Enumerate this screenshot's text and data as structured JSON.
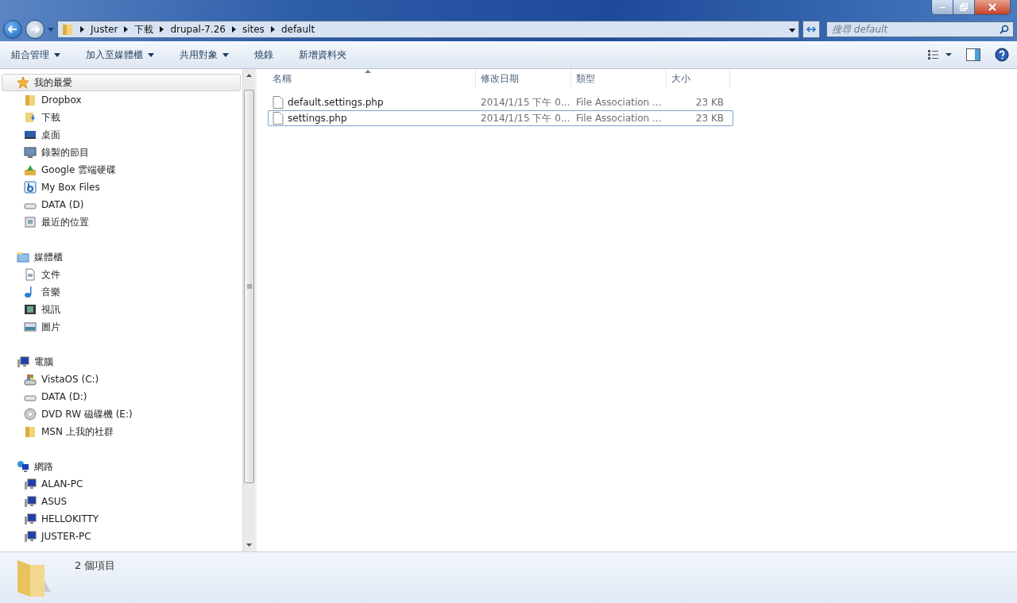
{
  "address_bar": {
    "crumbs": [
      "Juster",
      "下載",
      "drupal-7.26",
      "sites",
      "default"
    ]
  },
  "search": {
    "placeholder": "搜尋 default"
  },
  "toolbar": {
    "buttons": [
      {
        "label": "組合管理",
        "dropdown": true
      },
      {
        "label": "加入至媒體櫃",
        "dropdown": true
      },
      {
        "label": "共用對象",
        "dropdown": true
      },
      {
        "label": "燒錄",
        "dropdown": false
      },
      {
        "label": "新增資料夾",
        "dropdown": false
      }
    ]
  },
  "sidebar": {
    "groups": [
      {
        "label": "我的最愛",
        "kind": "star",
        "selected": true,
        "items": [
          {
            "label": "Dropbox",
            "kind": "folder"
          },
          {
            "label": "下載",
            "kind": "download"
          },
          {
            "label": "桌面",
            "kind": "desktop"
          },
          {
            "label": "錄製的節目",
            "kind": "monitor"
          },
          {
            "label": "Google 雲端硬碟",
            "kind": "drive"
          },
          {
            "label": "My Box Files",
            "kind": "box"
          },
          {
            "label": "DATA (D)",
            "kind": "disk"
          },
          {
            "label": "最近的位置",
            "kind": "recent"
          }
        ]
      },
      {
        "label": "媒體櫃",
        "kind": "library",
        "selected": false,
        "items": [
          {
            "label": "文件",
            "kind": "doc"
          },
          {
            "label": "音樂",
            "kind": "music"
          },
          {
            "label": "視訊",
            "kind": "film"
          },
          {
            "label": "圖片",
            "kind": "image"
          }
        ]
      },
      {
        "label": "電腦",
        "kind": "computer",
        "selected": false,
        "items": [
          {
            "label": "VistaOS (C:)",
            "kind": "sysdisk"
          },
          {
            "label": "DATA (D:)",
            "kind": "disk"
          },
          {
            "label": "DVD RW 磁碟機 (E:)",
            "kind": "dvd"
          },
          {
            "label": "MSN 上我的社群",
            "kind": "folder"
          }
        ]
      },
      {
        "label": "網路",
        "kind": "network",
        "selected": false,
        "items": [
          {
            "label": "ALAN-PC",
            "kind": "computer"
          },
          {
            "label": "ASUS",
            "kind": "computer"
          },
          {
            "label": "HELLOKITTY",
            "kind": "computer"
          },
          {
            "label": "JUSTER-PC",
            "kind": "computer"
          }
        ]
      }
    ]
  },
  "table": {
    "columns": [
      "名稱",
      "修改日期",
      "類型",
      "大小"
    ],
    "rows": [
      {
        "name": "default.settings.php",
        "modified": "2014/1/15 下午 0...",
        "type": "File Association ...",
        "size": "23 KB",
        "focused": false
      },
      {
        "name": "settings.php",
        "modified": "2014/1/15 下午 0...",
        "type": "File Association ...",
        "size": "23 KB",
        "focused": true
      }
    ]
  },
  "status_bar": {
    "text": "2 個項目"
  }
}
